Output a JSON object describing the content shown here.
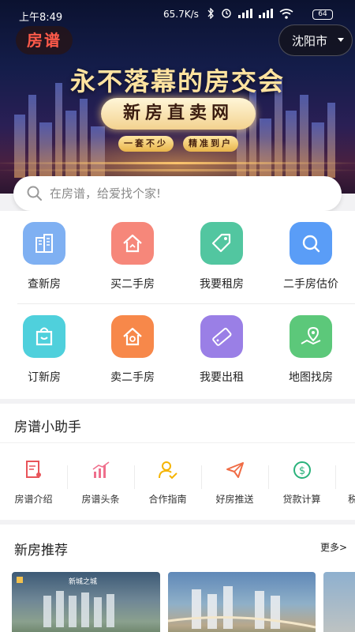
{
  "status_bar": {
    "time": "上午8:49",
    "network_speed": "65.7K/s",
    "battery": "64"
  },
  "header": {
    "logo_text": "房谱",
    "city": "沈阳市"
  },
  "banner": {
    "headline": "永不落幕的房交会",
    "pill": "新房直卖网",
    "tag_left": "一套不少",
    "tag_right": "精准到户"
  },
  "search": {
    "placeholder": "在房谱，给爱找个家!"
  },
  "quick_grid": [
    {
      "label": "查新房",
      "icon": "building-icon",
      "color": "#7fb0f2"
    },
    {
      "label": "买二手房",
      "icon": "house-icon",
      "color": "#f6877a"
    },
    {
      "label": "我要租房",
      "icon": "tag-icon",
      "color": "#52c6a0"
    },
    {
      "label": "二手房估价",
      "icon": "magnifier-icon",
      "color": "#5a9df7"
    },
    {
      "label": "订新房",
      "icon": "shopping-bag-icon",
      "color": "#4fd0dc"
    },
    {
      "label": "卖二手房",
      "icon": "house-sale-icon",
      "color": "#f7884a"
    },
    {
      "label": "我要出租",
      "icon": "rent-tag-icon",
      "color": "#9a7fe6"
    },
    {
      "label": "地图找房",
      "icon": "map-pin-icon",
      "color": "#5cc87a"
    }
  ],
  "helper": {
    "title": "房谱小助手",
    "items": [
      {
        "label": "房谱介绍",
        "icon": "document-person-icon",
        "color": "#e8545a"
      },
      {
        "label": "房谱头条",
        "icon": "bar-chart-icon",
        "color": "#ef6f8c"
      },
      {
        "label": "合作指南",
        "icon": "person-check-icon",
        "color": "#f5b400"
      },
      {
        "label": "好房推送",
        "icon": "paper-plane-icon",
        "color": "#f06c45"
      },
      {
        "label": "贷款计算",
        "icon": "dollar-circle-icon",
        "color": "#2ab27b"
      },
      {
        "label": "税",
        "icon": "tax-icon",
        "color": "#333333"
      }
    ]
  },
  "recommend": {
    "title": "新房推荐",
    "more": "更多>",
    "card1_badge": "新城之城"
  }
}
